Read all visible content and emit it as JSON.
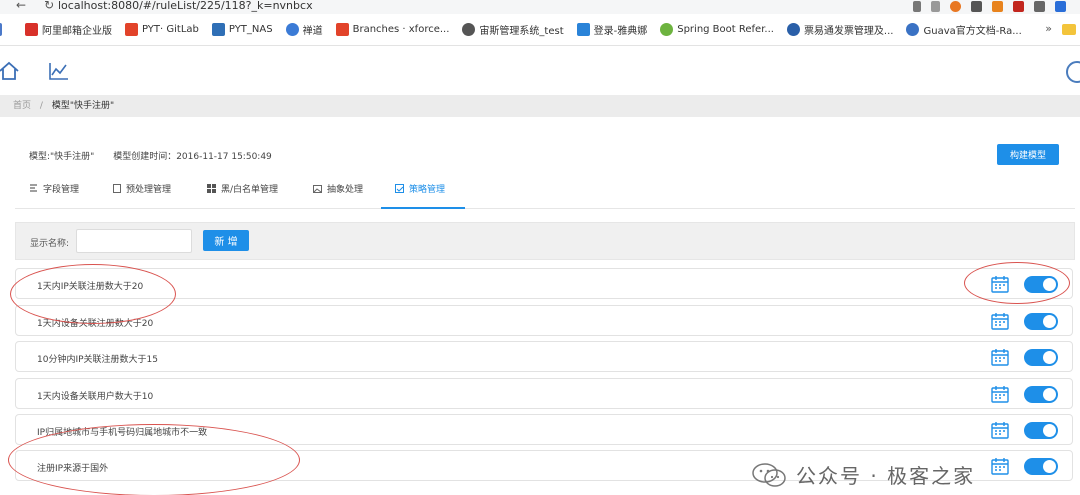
{
  "browser": {
    "url": "localhost:8080/#/ruleList/225/118?_k=nvnbcx",
    "bookmarks": [
      {
        "label": "阿里邮箱企业版",
        "color": "#d8312a"
      },
      {
        "label": "PYT· GitLab",
        "color": "#e2432a"
      },
      {
        "label": "PYT_NAS",
        "color": "#2f6fb6"
      },
      {
        "label": "禅道",
        "color": "#3b7bd6"
      },
      {
        "label": "Branches · xforce...",
        "color": "#e2432a"
      },
      {
        "label": "宙斯管理系统_test",
        "color": "#555555"
      },
      {
        "label": "登录-雅典娜",
        "color": "#2a83d8"
      },
      {
        "label": "Spring Boot Refer...",
        "color": "#6db33f"
      },
      {
        "label": "票易通发票管理及...",
        "color": "#2a5fa8"
      },
      {
        "label": "Guava官方文档-Ra...",
        "color": "#3a72c4"
      }
    ],
    "more": "»"
  },
  "breadcrumb": {
    "home": "首页",
    "sep": "/",
    "current": "模型\"快手注册\""
  },
  "model": {
    "name_label": "模型:\"快手注册\"",
    "created_label": "模型创建时间：2016-11-17 15:50:49",
    "build_button": "构建模型"
  },
  "tabs": [
    {
      "label": "字段管理",
      "icon": "field-icon"
    },
    {
      "label": "预处理管理",
      "icon": "document-icon"
    },
    {
      "label": "黑/白名单管理",
      "icon": "grid-icon"
    },
    {
      "label": "抽象处理",
      "icon": "image-icon"
    },
    {
      "label": "策略管理",
      "icon": "strategy-icon",
      "active": true
    }
  ],
  "filter": {
    "label": "显示名称:",
    "placeholder": "",
    "add_button": "新 增"
  },
  "rules": [
    {
      "name": "1天内IP关联注册数大于20",
      "enabled": true
    },
    {
      "name": "1天内设备关联注册数大于20",
      "enabled": true
    },
    {
      "name": "10分钟内IP关联注册数大于15",
      "enabled": true
    },
    {
      "name": "1天内设备关联用户数大于10",
      "enabled": true
    },
    {
      "name": "IP归属地城市与手机号码归属地城市不一致",
      "enabled": true
    },
    {
      "name": "注册IP来源于国外",
      "enabled": true
    }
  ],
  "watermark": "公众号 · 极客之家",
  "colors": {
    "primary": "#1e8fe8",
    "annotation": "#d9534f"
  }
}
